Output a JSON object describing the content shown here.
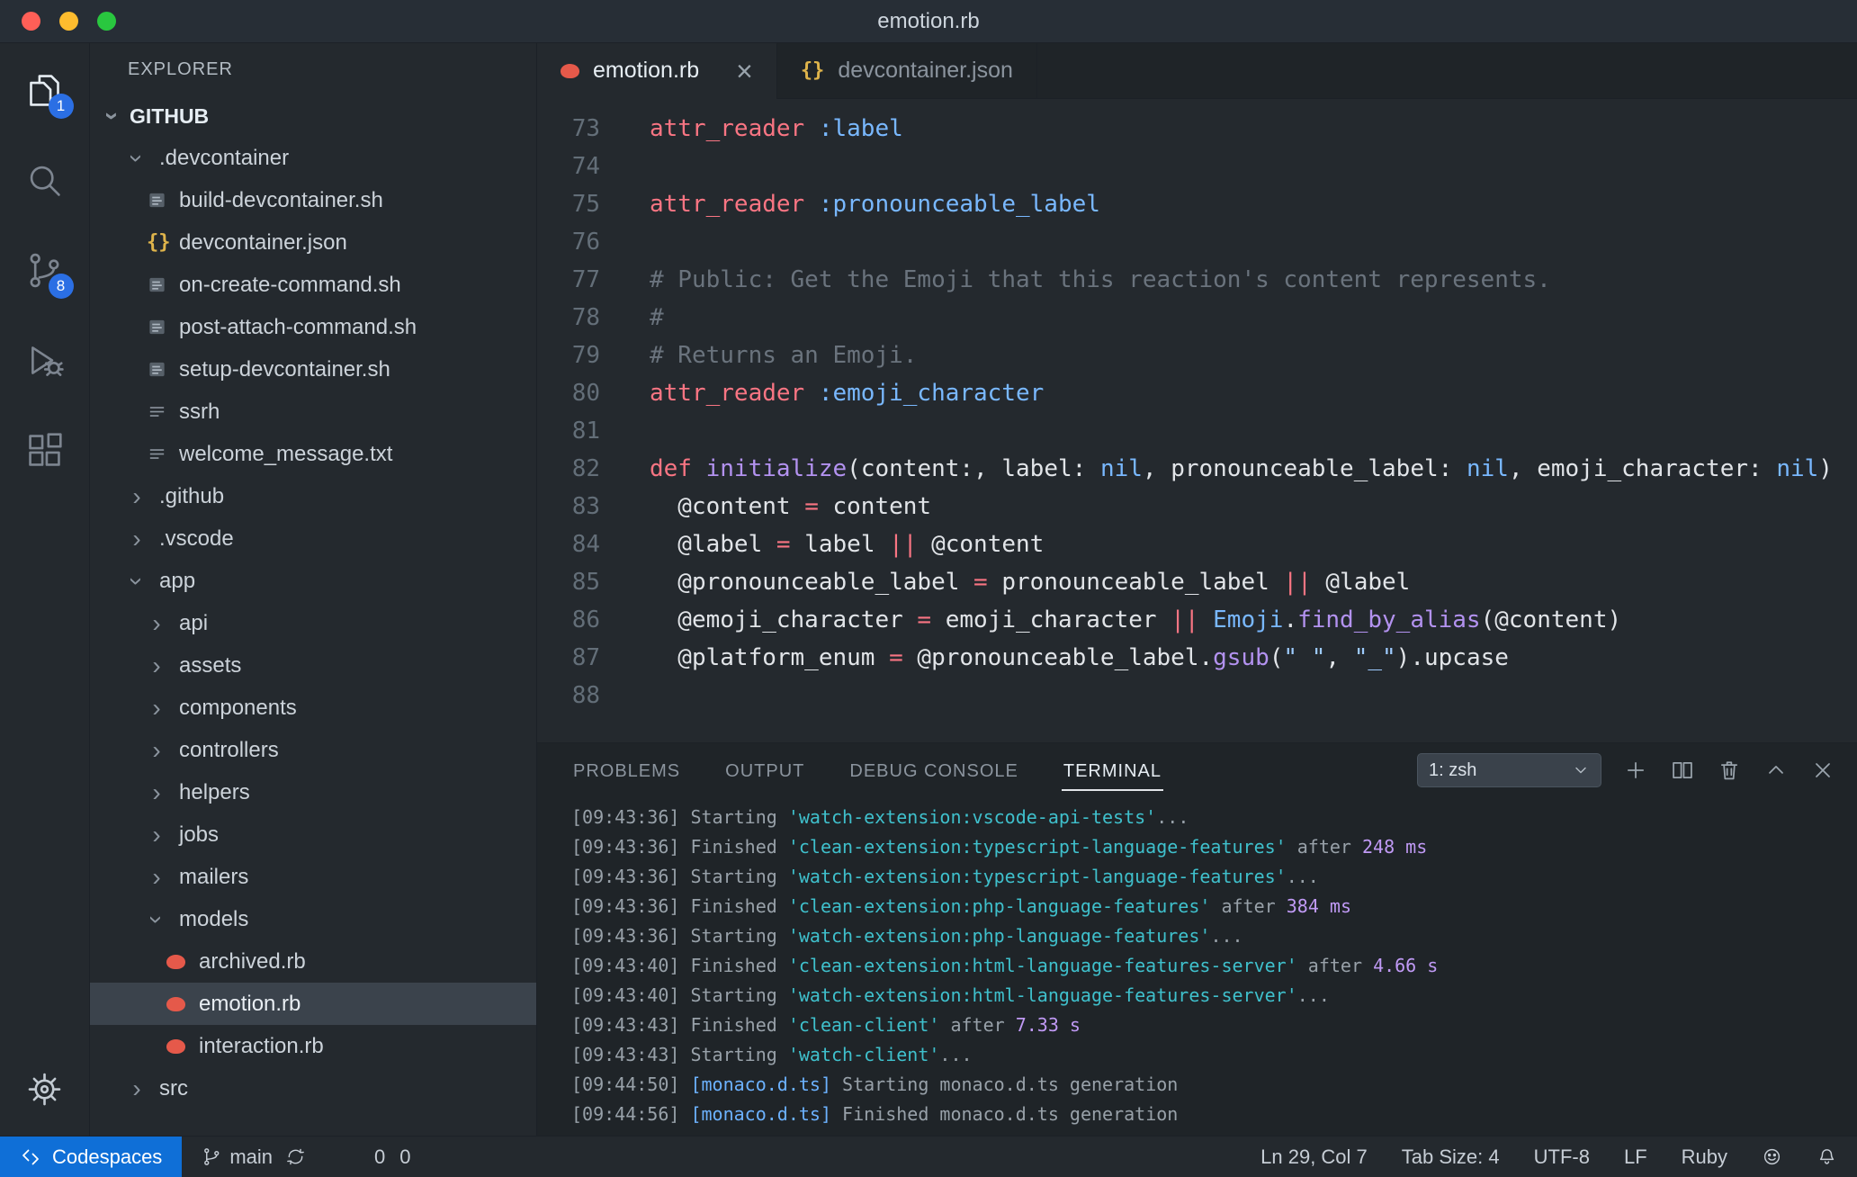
{
  "window": {
    "title": "emotion.rb"
  },
  "glyphs": {
    "chevron": "›",
    "close": "×",
    "braces": "{}"
  },
  "activity_bar": {
    "explorer_badge": "1",
    "scm_badge": "8"
  },
  "sidebar": {
    "header": "EXPLORER",
    "section": "GITHUB",
    "tree": [
      {
        "label": ".devcontainer",
        "kind": "folder",
        "expanded": true,
        "depth": 1
      },
      {
        "label": "build-devcontainer.sh",
        "kind": "shell",
        "depth": 2
      },
      {
        "label": "devcontainer.json",
        "kind": "json",
        "depth": 2
      },
      {
        "label": "on-create-command.sh",
        "kind": "shell",
        "depth": 2
      },
      {
        "label": "post-attach-command.sh",
        "kind": "shell",
        "depth": 2
      },
      {
        "label": "setup-devcontainer.sh",
        "kind": "shell",
        "depth": 2
      },
      {
        "label": "ssrh",
        "kind": "text",
        "depth": 2
      },
      {
        "label": "welcome_message.txt",
        "kind": "text",
        "depth": 2
      },
      {
        "label": ".github",
        "kind": "folder",
        "expanded": false,
        "depth": 1
      },
      {
        "label": ".vscode",
        "kind": "folder",
        "expanded": false,
        "depth": 1
      },
      {
        "label": "app",
        "kind": "folder",
        "expanded": true,
        "depth": 1
      },
      {
        "label": "api",
        "kind": "folder",
        "expanded": false,
        "depth": 2
      },
      {
        "label": "assets",
        "kind": "folder",
        "expanded": false,
        "depth": 2
      },
      {
        "label": "components",
        "kind": "folder",
        "expanded": false,
        "depth": 2
      },
      {
        "label": "controllers",
        "kind": "folder",
        "expanded": false,
        "depth": 2
      },
      {
        "label": "helpers",
        "kind": "folder",
        "expanded": false,
        "depth": 2
      },
      {
        "label": "jobs",
        "kind": "folder",
        "expanded": false,
        "depth": 2
      },
      {
        "label": "mailers",
        "kind": "folder",
        "expanded": false,
        "depth": 2
      },
      {
        "label": "models",
        "kind": "folder",
        "expanded": true,
        "depth": 2
      },
      {
        "label": "archived.rb",
        "kind": "ruby",
        "depth": 3
      },
      {
        "label": "emotion.rb",
        "kind": "ruby",
        "depth": 3,
        "selected": true
      },
      {
        "label": "interaction.rb",
        "kind": "ruby",
        "depth": 3
      },
      {
        "label": "src",
        "kind": "folder",
        "expanded": false,
        "depth": 1
      }
    ]
  },
  "tabs": [
    {
      "label": "emotion.rb",
      "icon": "ruby",
      "active": true
    },
    {
      "label": "devcontainer.json",
      "icon": "json",
      "active": false
    }
  ],
  "editor": {
    "lines": [
      {
        "no": "73",
        "tokens": [
          [
            "attr_reader",
            "r"
          ],
          [
            " ",
            "f"
          ],
          [
            ":label",
            "b"
          ]
        ]
      },
      {
        "no": "74",
        "tokens": []
      },
      {
        "no": "75",
        "tokens": [
          [
            "attr_reader",
            "r"
          ],
          [
            " ",
            "f"
          ],
          [
            ":pronounceable_label",
            "b"
          ]
        ]
      },
      {
        "no": "76",
        "tokens": []
      },
      {
        "no": "77",
        "tokens": [
          [
            "# Public: Get the Emoji that this reaction's content represents.",
            "c"
          ]
        ]
      },
      {
        "no": "78",
        "tokens": [
          [
            "#",
            "c"
          ]
        ]
      },
      {
        "no": "79",
        "tokens": [
          [
            "# Returns an Emoji.",
            "c"
          ]
        ]
      },
      {
        "no": "80",
        "tokens": [
          [
            "attr_reader",
            "r"
          ],
          [
            " ",
            "f"
          ],
          [
            ":emoji_character",
            "b"
          ]
        ]
      },
      {
        "no": "81",
        "tokens": []
      },
      {
        "no": "82",
        "tokens": [
          [
            "def",
            "r"
          ],
          [
            " ",
            "f"
          ],
          [
            "initialize",
            "p"
          ],
          [
            "(content:, label: ",
            "f"
          ],
          [
            "nil",
            "b"
          ],
          [
            ", pronounceable_label: ",
            "f"
          ],
          [
            "nil",
            "b"
          ],
          [
            ", emoji_character: ",
            "f"
          ],
          [
            "nil",
            "b"
          ],
          [
            ")",
            "f"
          ]
        ]
      },
      {
        "no": "83",
        "tokens": [
          [
            "  @content ",
            "f"
          ],
          [
            "=",
            "r"
          ],
          [
            " content",
            "f"
          ]
        ]
      },
      {
        "no": "84",
        "tokens": [
          [
            "  @label ",
            "f"
          ],
          [
            "=",
            "r"
          ],
          [
            " label ",
            "f"
          ],
          [
            "||",
            "r"
          ],
          [
            " @content",
            "f"
          ]
        ]
      },
      {
        "no": "85",
        "tokens": [
          [
            "  @pronounceable_label ",
            "f"
          ],
          [
            "=",
            "r"
          ],
          [
            " pronounceable_label ",
            "f"
          ],
          [
            "||",
            "r"
          ],
          [
            " @label",
            "f"
          ]
        ]
      },
      {
        "no": "86",
        "tokens": [
          [
            "  @emoji_character ",
            "f"
          ],
          [
            "=",
            "r"
          ],
          [
            " emoji_character ",
            "f"
          ],
          [
            "||",
            "r"
          ],
          [
            " ",
            "f"
          ],
          [
            "Emoji",
            "b"
          ],
          [
            ".",
            "f"
          ],
          [
            "find_by_alias",
            "p"
          ],
          [
            "(@content)",
            "f"
          ]
        ]
      },
      {
        "no": "87",
        "tokens": [
          [
            "  @platform_enum ",
            "f"
          ],
          [
            "=",
            "r"
          ],
          [
            " @pronounceable_label.",
            "f"
          ],
          [
            "gsub",
            "p"
          ],
          [
            "(",
            "f"
          ],
          [
            "\" \"",
            "s"
          ],
          [
            ", ",
            "f"
          ],
          [
            "\"_\"",
            "s"
          ],
          [
            ").upcase",
            "f"
          ]
        ]
      },
      {
        "no": "88",
        "tokens": []
      }
    ]
  },
  "panel": {
    "tabs": [
      "PROBLEMS",
      "OUTPUT",
      "DEBUG CONSOLE",
      "TERMINAL"
    ],
    "active_tab": "TERMINAL",
    "shell_select": "1: zsh"
  },
  "terminal": {
    "lines": [
      [
        [
          "[09:43:36] Starting ",
          "g"
        ],
        [
          "'watch-extension:vscode-api-tests'",
          "c"
        ],
        [
          "...",
          "g"
        ]
      ],
      [
        [
          "[09:43:36] Finished ",
          "g"
        ],
        [
          "'clean-extension:typescript-language-features'",
          "c"
        ],
        [
          " after ",
          "g"
        ],
        [
          "248 ms",
          "p"
        ]
      ],
      [
        [
          "[09:43:36] Starting ",
          "g"
        ],
        [
          "'watch-extension:typescript-language-features'",
          "c"
        ],
        [
          "...",
          "g"
        ]
      ],
      [
        [
          "[09:43:36] Finished ",
          "g"
        ],
        [
          "'clean-extension:php-language-features'",
          "c"
        ],
        [
          " after ",
          "g"
        ],
        [
          "384 ms",
          "p"
        ]
      ],
      [
        [
          "[09:43:36] Starting ",
          "g"
        ],
        [
          "'watch-extension:php-language-features'",
          "c"
        ],
        [
          "...",
          "g"
        ]
      ],
      [
        [
          "[09:43:40] Finished ",
          "g"
        ],
        [
          "'clean-extension:html-language-features-server'",
          "c"
        ],
        [
          " after ",
          "g"
        ],
        [
          "4.66 s",
          "p"
        ]
      ],
      [
        [
          "[09:43:40] Starting ",
          "g"
        ],
        [
          "'watch-extension:html-language-features-server'",
          "c"
        ],
        [
          "...",
          "g"
        ]
      ],
      [
        [
          "[09:43:43] Finished ",
          "g"
        ],
        [
          "'clean-client'",
          "c"
        ],
        [
          " after ",
          "g"
        ],
        [
          "7.33 s",
          "p"
        ]
      ],
      [
        [
          "[09:43:43] Starting ",
          "g"
        ],
        [
          "'watch-client'",
          "c"
        ],
        [
          "...",
          "g"
        ]
      ],
      [
        [
          "[09:44:50] ",
          "g"
        ],
        [
          "[monaco.d.ts]",
          "b"
        ],
        [
          " Starting monaco.d.ts generation",
          "g"
        ]
      ],
      [
        [
          "[09:44:56] ",
          "g"
        ],
        [
          "[monaco.d.ts]",
          "b"
        ],
        [
          " Finished monaco.d.ts generation",
          "g"
        ]
      ]
    ]
  },
  "status_bar": {
    "codespaces": "Codespaces",
    "branch": "main",
    "errors": "0",
    "warnings": "0",
    "line_col": "Ln 29, Col 7",
    "tab_size": "Tab Size: 4",
    "encoding": "UTF-8",
    "eol": "LF",
    "language": "Ruby"
  }
}
